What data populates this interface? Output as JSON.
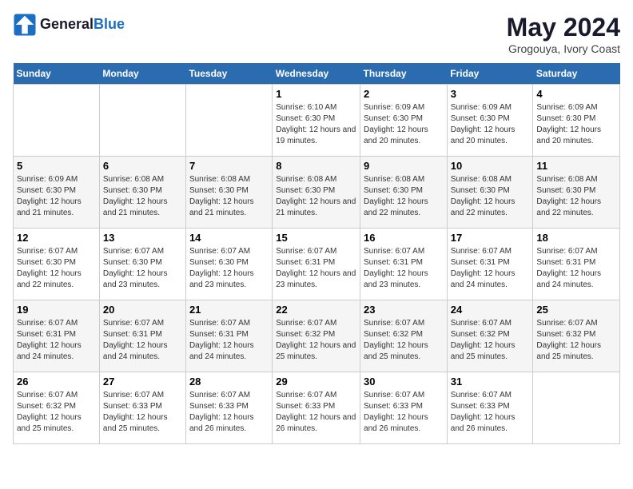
{
  "header": {
    "logo_line1": "General",
    "logo_line2": "Blue",
    "month": "May 2024",
    "location": "Grogouya, Ivory Coast"
  },
  "weekdays": [
    "Sunday",
    "Monday",
    "Tuesday",
    "Wednesday",
    "Thursday",
    "Friday",
    "Saturday"
  ],
  "weeks": [
    [
      {
        "num": "",
        "info": ""
      },
      {
        "num": "",
        "info": ""
      },
      {
        "num": "",
        "info": ""
      },
      {
        "num": "1",
        "info": "Sunrise: 6:10 AM\nSunset: 6:30 PM\nDaylight: 12 hours and 19 minutes."
      },
      {
        "num": "2",
        "info": "Sunrise: 6:09 AM\nSunset: 6:30 PM\nDaylight: 12 hours and 20 minutes."
      },
      {
        "num": "3",
        "info": "Sunrise: 6:09 AM\nSunset: 6:30 PM\nDaylight: 12 hours and 20 minutes."
      },
      {
        "num": "4",
        "info": "Sunrise: 6:09 AM\nSunset: 6:30 PM\nDaylight: 12 hours and 20 minutes."
      }
    ],
    [
      {
        "num": "5",
        "info": "Sunrise: 6:09 AM\nSunset: 6:30 PM\nDaylight: 12 hours and 21 minutes."
      },
      {
        "num": "6",
        "info": "Sunrise: 6:08 AM\nSunset: 6:30 PM\nDaylight: 12 hours and 21 minutes."
      },
      {
        "num": "7",
        "info": "Sunrise: 6:08 AM\nSunset: 6:30 PM\nDaylight: 12 hours and 21 minutes."
      },
      {
        "num": "8",
        "info": "Sunrise: 6:08 AM\nSunset: 6:30 PM\nDaylight: 12 hours and 21 minutes."
      },
      {
        "num": "9",
        "info": "Sunrise: 6:08 AM\nSunset: 6:30 PM\nDaylight: 12 hours and 22 minutes."
      },
      {
        "num": "10",
        "info": "Sunrise: 6:08 AM\nSunset: 6:30 PM\nDaylight: 12 hours and 22 minutes."
      },
      {
        "num": "11",
        "info": "Sunrise: 6:08 AM\nSunset: 6:30 PM\nDaylight: 12 hours and 22 minutes."
      }
    ],
    [
      {
        "num": "12",
        "info": "Sunrise: 6:07 AM\nSunset: 6:30 PM\nDaylight: 12 hours and 22 minutes."
      },
      {
        "num": "13",
        "info": "Sunrise: 6:07 AM\nSunset: 6:30 PM\nDaylight: 12 hours and 23 minutes."
      },
      {
        "num": "14",
        "info": "Sunrise: 6:07 AM\nSunset: 6:30 PM\nDaylight: 12 hours and 23 minutes."
      },
      {
        "num": "15",
        "info": "Sunrise: 6:07 AM\nSunset: 6:31 PM\nDaylight: 12 hours and 23 minutes."
      },
      {
        "num": "16",
        "info": "Sunrise: 6:07 AM\nSunset: 6:31 PM\nDaylight: 12 hours and 23 minutes."
      },
      {
        "num": "17",
        "info": "Sunrise: 6:07 AM\nSunset: 6:31 PM\nDaylight: 12 hours and 24 minutes."
      },
      {
        "num": "18",
        "info": "Sunrise: 6:07 AM\nSunset: 6:31 PM\nDaylight: 12 hours and 24 minutes."
      }
    ],
    [
      {
        "num": "19",
        "info": "Sunrise: 6:07 AM\nSunset: 6:31 PM\nDaylight: 12 hours and 24 minutes."
      },
      {
        "num": "20",
        "info": "Sunrise: 6:07 AM\nSunset: 6:31 PM\nDaylight: 12 hours and 24 minutes."
      },
      {
        "num": "21",
        "info": "Sunrise: 6:07 AM\nSunset: 6:31 PM\nDaylight: 12 hours and 24 minutes."
      },
      {
        "num": "22",
        "info": "Sunrise: 6:07 AM\nSunset: 6:32 PM\nDaylight: 12 hours and 25 minutes."
      },
      {
        "num": "23",
        "info": "Sunrise: 6:07 AM\nSunset: 6:32 PM\nDaylight: 12 hours and 25 minutes."
      },
      {
        "num": "24",
        "info": "Sunrise: 6:07 AM\nSunset: 6:32 PM\nDaylight: 12 hours and 25 minutes."
      },
      {
        "num": "25",
        "info": "Sunrise: 6:07 AM\nSunset: 6:32 PM\nDaylight: 12 hours and 25 minutes."
      }
    ],
    [
      {
        "num": "26",
        "info": "Sunrise: 6:07 AM\nSunset: 6:32 PM\nDaylight: 12 hours and 25 minutes."
      },
      {
        "num": "27",
        "info": "Sunrise: 6:07 AM\nSunset: 6:33 PM\nDaylight: 12 hours and 25 minutes."
      },
      {
        "num": "28",
        "info": "Sunrise: 6:07 AM\nSunset: 6:33 PM\nDaylight: 12 hours and 26 minutes."
      },
      {
        "num": "29",
        "info": "Sunrise: 6:07 AM\nSunset: 6:33 PM\nDaylight: 12 hours and 26 minutes."
      },
      {
        "num": "30",
        "info": "Sunrise: 6:07 AM\nSunset: 6:33 PM\nDaylight: 12 hours and 26 minutes."
      },
      {
        "num": "31",
        "info": "Sunrise: 6:07 AM\nSunset: 6:33 PM\nDaylight: 12 hours and 26 minutes."
      },
      {
        "num": "",
        "info": ""
      }
    ]
  ]
}
